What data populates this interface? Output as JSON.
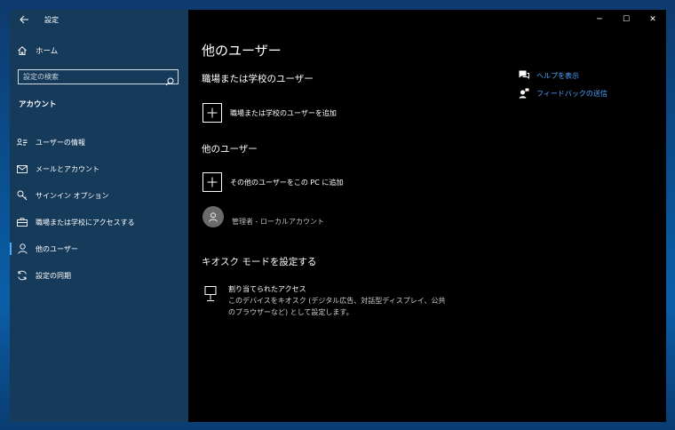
{
  "app": {
    "title": "設定"
  },
  "sidebar": {
    "home_label": "ホーム",
    "search_placeholder": "設定の検索",
    "section_title": "アカウント",
    "items": [
      {
        "label": "ユーザーの情報",
        "icon": "user-card-icon"
      },
      {
        "label": "メールとアカウント",
        "icon": "mail-icon"
      },
      {
        "label": "サインイン オプション",
        "icon": "key-icon"
      },
      {
        "label": "職場または学校にアクセスする",
        "icon": "briefcase-icon"
      },
      {
        "label": "他のユーザー",
        "icon": "person-icon",
        "active": true
      },
      {
        "label": "設定の同期",
        "icon": "sync-icon"
      }
    ]
  },
  "window_controls": {
    "minimize": "─",
    "maximize": "☐",
    "close": "✕"
  },
  "main": {
    "title": "他のユーザー",
    "work_school_heading": "職場または学校のユーザー",
    "add_work_user_label": "職場または学校のユーザーを追加",
    "other_users_heading": "他のユーザー",
    "add_other_user_label": "その他のユーザーをこの PC に追加",
    "existing_user": "管理者 - ローカルアカウント",
    "kiosk_heading": "キオスク モードを設定する",
    "kiosk_item_title": "割り当てられたアクセス",
    "kiosk_item_desc": "このデバイスをキオスク (デジタル広告、対話型ディスプレイ、公共のブラウザーなど) として設定します。"
  },
  "help_links": {
    "help_label": "ヘルプを表示",
    "feedback_label": "フィードバックの送信"
  },
  "colors": {
    "accent": "#4ca6ff",
    "sidebar_bg": "#163a5a",
    "content_bg": "#000000"
  }
}
